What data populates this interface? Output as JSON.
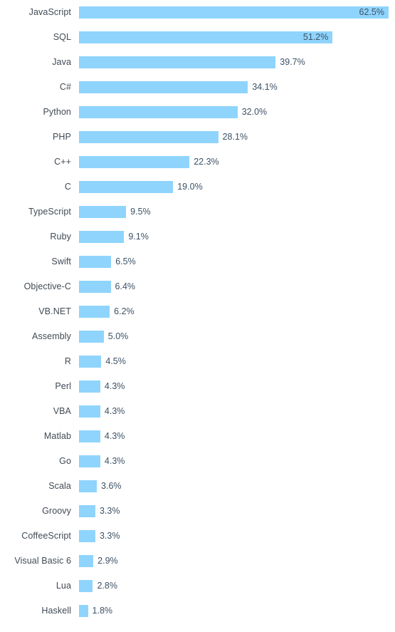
{
  "chart_data": {
    "type": "bar",
    "orientation": "horizontal",
    "title": "",
    "subtitle": "",
    "xlabel": "",
    "ylabel": "",
    "xlim": [
      0,
      62.5
    ],
    "grid": false,
    "legend": null,
    "value_suffix": "%",
    "bar_color": "#8fd4fc",
    "label_color": "#404a54",
    "value_color": "#3d5266",
    "background": "#ffffff",
    "categories": [
      "JavaScript",
      "SQL",
      "Java",
      "C#",
      "Python",
      "PHP",
      "C++",
      "C",
      "TypeScript",
      "Ruby",
      "Swift",
      "Objective-C",
      "VB.NET",
      "Assembly",
      "R",
      "Perl",
      "VBA",
      "Matlab",
      "Go",
      "Scala",
      "Groovy",
      "CoffeeScript",
      "Visual Basic 6",
      "Lua",
      "Haskell"
    ],
    "values": [
      62.5,
      51.2,
      39.7,
      34.1,
      32.0,
      28.1,
      22.3,
      19.0,
      9.5,
      9.1,
      6.5,
      6.4,
      6.2,
      5.0,
      4.5,
      4.3,
      4.3,
      4.3,
      4.3,
      3.6,
      3.3,
      3.3,
      2.9,
      2.8,
      1.8
    ],
    "value_labels": [
      "62.5%",
      "51.2%",
      "39.7%",
      "34.1%",
      "32.0%",
      "28.1%",
      "22.3%",
      "19.0%",
      "9.5%",
      "9.1%",
      "6.5%",
      "6.4%",
      "6.2%",
      "5.0%",
      "4.5%",
      "4.3%",
      "4.3%",
      "4.3%",
      "4.3%",
      "3.6%",
      "3.3%",
      "3.3%",
      "2.9%",
      "2.8%",
      "1.8%"
    ],
    "label_inside": [
      true,
      true,
      false,
      false,
      false,
      false,
      false,
      false,
      false,
      false,
      false,
      false,
      false,
      false,
      false,
      false,
      false,
      false,
      false,
      false,
      false,
      false,
      false,
      false,
      false
    ]
  }
}
